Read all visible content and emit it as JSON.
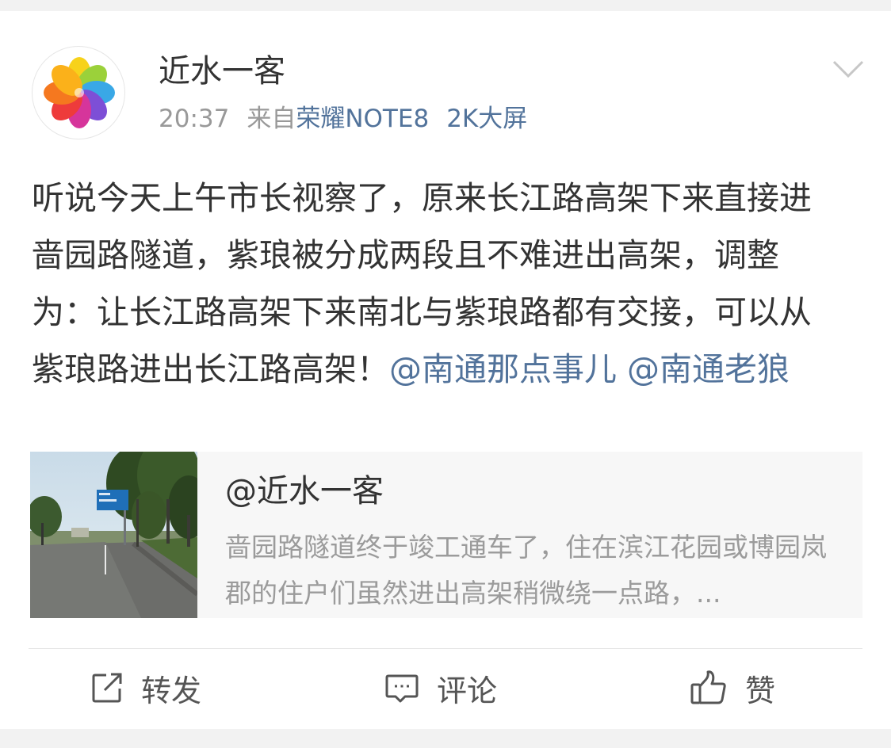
{
  "user": {
    "name": "近水一客",
    "time": "20:37",
    "source_prefix": "来自",
    "source_device": "荣耀NOTE8",
    "source_extra": "2K大屏"
  },
  "post": {
    "text": "听说今天上午市长视察了，原来长江路高架下来直接进啬园路隧道，紫琅被分成两段且不难进出高架，调整为：让长江路高架下来南北与紫琅路都有交接，可以从紫琅路进出长江路高架！",
    "mention1": "@南通那点事儿",
    "mention2": "@南通老狼"
  },
  "share": {
    "title": "@近水一客",
    "description": "啬园路隧道终于竣工通车了，住在滨江花园或博园岚郡的住户们虽然进出高架稍微绕一点路，..."
  },
  "actions": {
    "repost": "转发",
    "comment": "评论",
    "like": "赞"
  },
  "colors": {
    "link": "#52739b",
    "text": "#333333",
    "meta": "#999999"
  },
  "icons": {
    "menu": "chevron-down-icon",
    "repost": "repost-icon",
    "comment": "comment-icon",
    "like": "thumbs-up-icon"
  }
}
